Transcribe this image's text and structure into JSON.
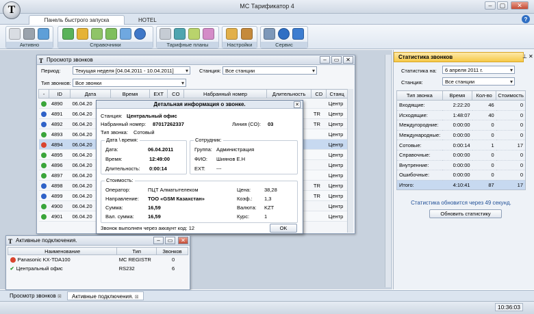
{
  "window": {
    "title": "MC Тарификатор 4",
    "logo": "T"
  },
  "ribbon": {
    "tabs": [
      "Панель быстрого запуска",
      "HOTEL"
    ],
    "groups": [
      {
        "label": "Активно"
      },
      {
        "label": "Справочники"
      },
      {
        "label": "Тарифные планы"
      },
      {
        "label": "Настройки"
      },
      {
        "label": "Сервис"
      }
    ]
  },
  "calls_window": {
    "title": "Просмотр звонков",
    "filters": {
      "period_label": "Период:",
      "period_value": "Текущая неделя [04.04.2011 - 10.04.2011]",
      "station_label": "Станция:",
      "station_value": "Все станции",
      "call_type_label": "Тип звонков:",
      "call_type_value": "Все звонки"
    },
    "columns": [
      "-",
      "ID",
      "Дата",
      "Время",
      "EXT",
      "CO",
      "Набранный номер",
      "Длительность",
      "CD",
      "Станц"
    ],
    "rows": [
      {
        "status": "green",
        "id": "4890",
        "date": "06.04.20",
        "cd": "",
        "station": "Центр"
      },
      {
        "status": "blue",
        "id": "4891",
        "date": "06.04.20",
        "cd": "TR",
        "station": "Центр"
      },
      {
        "status": "blue",
        "id": "4892",
        "date": "06.04.20",
        "cd": "TR",
        "station": "Центр"
      },
      {
        "status": "green",
        "id": "4893",
        "date": "06.04.20",
        "cd": "",
        "station": "Центр"
      },
      {
        "status": "red",
        "id": "4894",
        "date": "06.04.20",
        "cd": "",
        "station": "Центр",
        "selected": true
      },
      {
        "status": "green",
        "id": "4895",
        "date": "06.04.20",
        "cd": "",
        "station": "Центр"
      },
      {
        "status": "green",
        "id": "4896",
        "date": "06.04.20",
        "cd": "",
        "station": "Центр"
      },
      {
        "status": "green",
        "id": "4897",
        "date": "06.04.20",
        "cd": "",
        "station": "Центр"
      },
      {
        "status": "blue",
        "id": "4898",
        "date": "06.04.20",
        "cd": "TR",
        "station": "Центр"
      },
      {
        "status": "blue",
        "id": "4899",
        "date": "06.04.20",
        "cd": "TR",
        "station": "Центр"
      },
      {
        "status": "green",
        "id": "4900",
        "date": "06.04.20",
        "cd": "",
        "station": "Центр"
      },
      {
        "status": "green",
        "id": "4901",
        "date": "06.04.20",
        "cd": "",
        "station": "Центр"
      }
    ]
  },
  "detail": {
    "title": "Детальная информация о звонке.",
    "station_label": "Станция:",
    "station": "Центральный офис",
    "number_label": "Набранный номер:",
    "number": "87017262337",
    "line_label": "Линия (CO):",
    "line": "03",
    "type_label": "Тип звонка:",
    "type": "Сотовый",
    "datetime_legend": "Дата \\ время:",
    "date_label": "Дата:",
    "date": "06.04.2011",
    "time_label": "Время:",
    "time": "12:49:00",
    "duration_label": "Длительность:",
    "duration": "0:00:14",
    "employee_legend": "Сотрудник:",
    "group_label": "Группа:",
    "group": "Администрация",
    "fio_label": "ФИО:",
    "fio": "Шиянов Е.Н",
    "ext_label": "EXT:",
    "ext": "---",
    "cost_legend": "Стоимость:",
    "operator_label": "Оператор:",
    "operator": "ПЦТ Алматытелеком",
    "direction_label": "Направление:",
    "direction": "ТОО «GSM Казахстан»",
    "sum_label": "Сумма:",
    "sum": "16,59",
    "valsum_label": "Вал. сумма:",
    "valsum": "16,59",
    "price_label": "Цена:",
    "price": "38,28",
    "coef_label": "Коэф.:",
    "coef": "1,3",
    "currency_label": "Валюта:",
    "currency": "KZT",
    "rate_label": "Курс:",
    "rate": "1",
    "footer": "Звонок выполнен через аккаунт код: 12",
    "ok": "OK"
  },
  "active": {
    "title": "Активные подключения.",
    "columns": [
      "Наименование",
      "Тип",
      "Звонков"
    ],
    "rows": [
      {
        "status": "error",
        "name": "Panasonic KX-TDA100",
        "type": "MC REGISTR",
        "calls": "0"
      },
      {
        "status": "ok",
        "name": "Центральный офис",
        "type": "RS232",
        "calls": "6"
      }
    ]
  },
  "stats": {
    "title": "Статистика звонков",
    "date_label": "Статистика на:",
    "date_value": "6  апреля  2011 г.",
    "station_label": "Станция:",
    "station_value": "Все станции",
    "columns": [
      "Тип звонка",
      "Время",
      "Кол-во",
      "Стоимость"
    ],
    "rows": [
      {
        "type": "Входящие:",
        "time": "2:22:20",
        "count": "46",
        "cost": "0"
      },
      {
        "type": "Исходящие:",
        "time": "1:48:07",
        "count": "40",
        "cost": "0"
      },
      {
        "type": "Междугородние:",
        "time": "0:00:00",
        "count": "0",
        "cost": "0"
      },
      {
        "type": "Международные:",
        "time": "0:00:00",
        "count": "0",
        "cost": "0"
      },
      {
        "type": "Сотовые:",
        "time": "0:00:14",
        "count": "1",
        "cost": "17"
      },
      {
        "type": "Справочные:",
        "time": "0:00:00",
        "count": "0",
        "cost": "0"
      },
      {
        "type": "Внутренние:",
        "time": "0:00:00",
        "count": "0",
        "cost": "0"
      },
      {
        "type": "Ошибочные:",
        "time": "0:00:00",
        "count": "0",
        "cost": "0"
      }
    ],
    "total": {
      "type": "Итого:",
      "time": "4:10:41",
      "count": "87",
      "cost": "17"
    },
    "refresh_note": "Статистика обновится через 49 секунд.",
    "refresh_button": "Обновить статистику"
  },
  "bottom_tabs": [
    "Просмотр звонков",
    "Активные подключения."
  ],
  "status": {
    "clock": "10:36:03"
  },
  "colors": {
    "accent": "#f6c948",
    "selected": "#c7d9f0",
    "green": "#3aa53a",
    "blue": "#2f62c8",
    "red": "#d9442e"
  }
}
